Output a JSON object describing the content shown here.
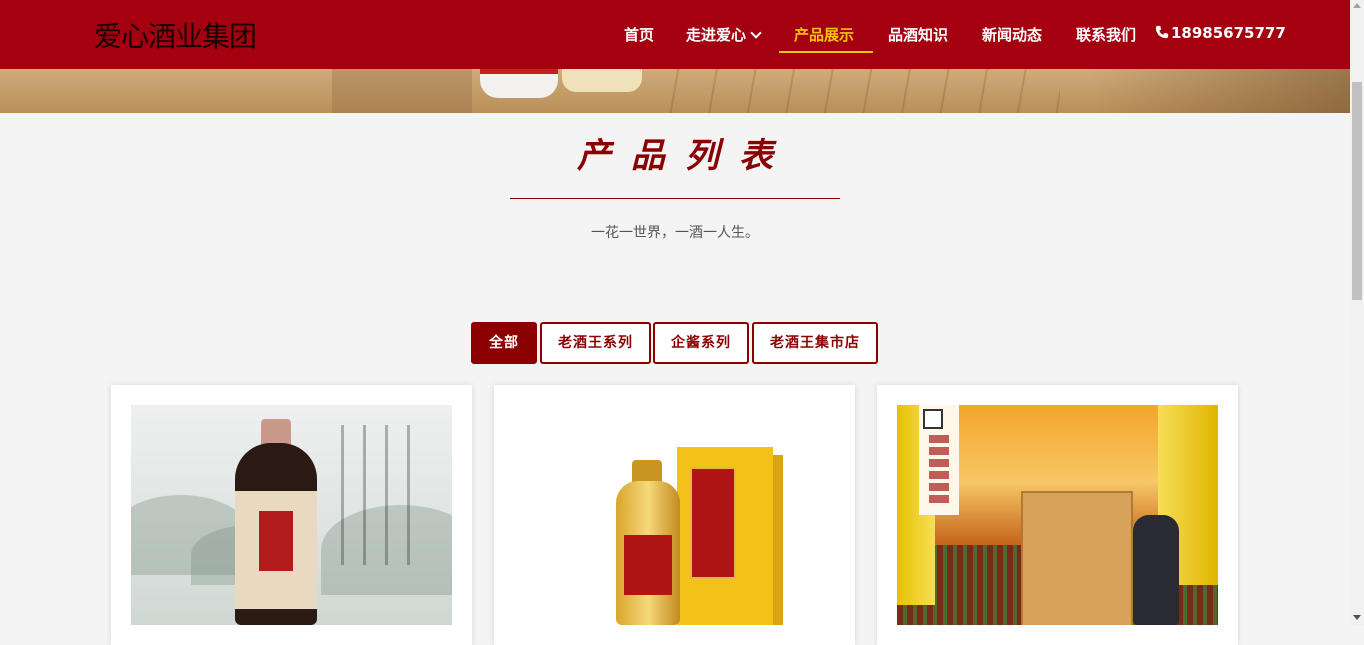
{
  "header": {
    "logo_text": "爱心酒业集团",
    "nav": [
      {
        "label": "首页"
      },
      {
        "label": "走进爱心"
      },
      {
        "label": "产品展示"
      },
      {
        "label": "品酒知识"
      },
      {
        "label": "新闻动态"
      },
      {
        "label": "联系我们"
      }
    ],
    "phone": "18985675777",
    "brand_color": "#a50010",
    "active_color": "#f6c30c"
  },
  "section": {
    "title": "产品列表",
    "subtitle": "一花一世界，一酒一人生。"
  },
  "filters": [
    {
      "label": "全部",
      "active": true
    },
    {
      "label": "老酒王系列",
      "active": false
    },
    {
      "label": "企酱系列",
      "active": false
    },
    {
      "label": "老酒王集市店",
      "active": false
    }
  ],
  "products": [
    {
      "icon": "liquor-bottle-image"
    },
    {
      "icon": "liquor-gift-box-image"
    },
    {
      "icon": "liquor-wooden-box-image"
    }
  ]
}
